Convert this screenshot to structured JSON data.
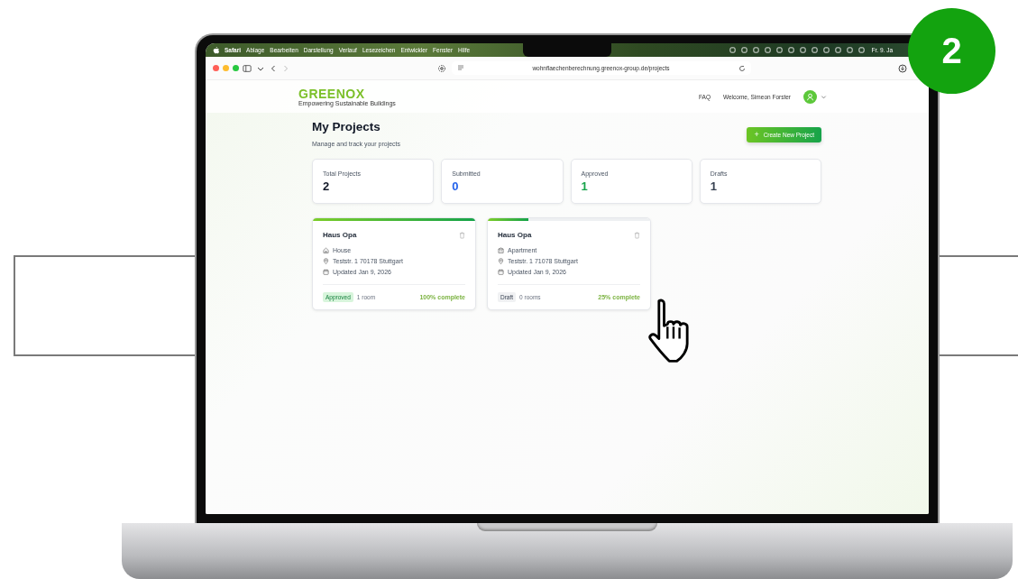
{
  "badge": {
    "label": "2"
  },
  "menu_bar": {
    "app": "Safari",
    "items": [
      "Ablage",
      "Bearbeiten",
      "Darstellung",
      "Verlauf",
      "Lesezeichen",
      "Entwickler",
      "Fenster",
      "Hilfe"
    ],
    "clock": "Fr. 9. Ja"
  },
  "browser": {
    "url": "wohnflaechenberechnung.greenox-group.de/projects"
  },
  "header": {
    "logo": "GREENOX",
    "tagline": "Empowering Sustainable Buildings",
    "faq": "FAQ",
    "welcome": "Welcome, Simeon Forster"
  },
  "page": {
    "title": "My Projects",
    "subtitle": "Manage and track your projects",
    "create_button": "Create New Project",
    "create_icon": "+"
  },
  "stats": [
    {
      "label": "Total Projects",
      "value": "2",
      "color": "#111827"
    },
    {
      "label": "Submitted",
      "value": "0",
      "color": "#2563eb"
    },
    {
      "label": "Approved",
      "value": "1",
      "color": "#16a34a"
    },
    {
      "label": "Drafts",
      "value": "1",
      "color": "#374151"
    }
  ],
  "projects": [
    {
      "name": "Haus Opa",
      "kind": "house",
      "type": "House",
      "address": "Teststr. 1 70178 Stuttgart",
      "updated": "Updated Jan 9, 2026",
      "status": {
        "label": "Approved",
        "kind": "approved"
      },
      "rooms": "1 room",
      "progress": "100% complete",
      "level": 1
    },
    {
      "name": "Haus Opa",
      "kind": "apartment",
      "type": "Apartment",
      "address": "Teststr. 1 71078 Stuttgart",
      "updated": "Updated Jan 9, 2026",
      "status": {
        "label": "Draft",
        "kind": "draft"
      },
      "rooms": "0 rooms",
      "progress": "25% complete",
      "level": 0.25
    }
  ]
}
